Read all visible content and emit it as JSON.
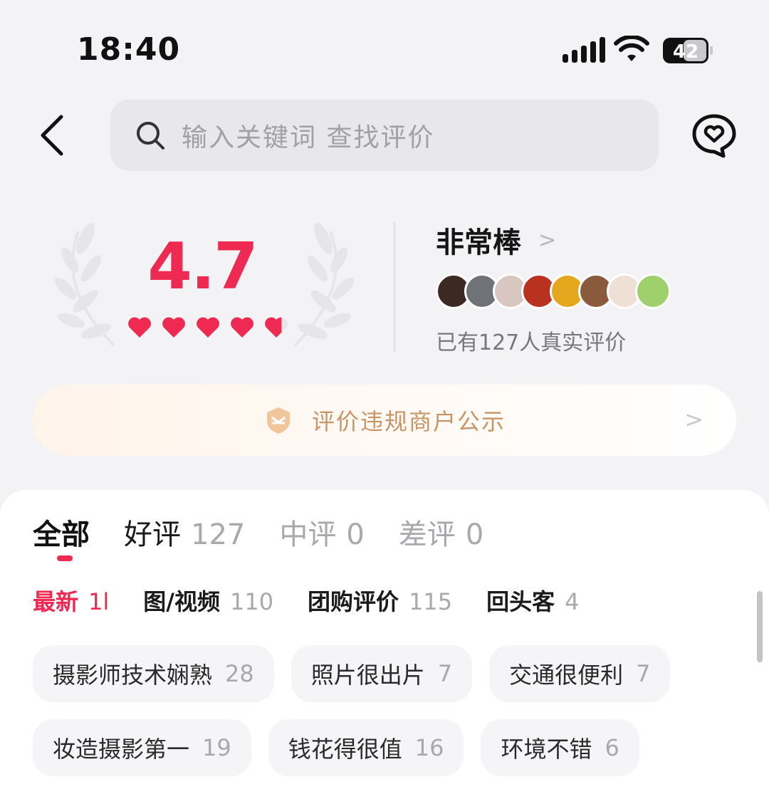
{
  "status_bar": {
    "time": "18:40",
    "battery": "42"
  },
  "search": {
    "placeholder": "输入关键词 查找评价"
  },
  "summary": {
    "score": "4.7",
    "stars_filled": 4.7,
    "rating_label": "非常棒",
    "review_count_text": "已有127人真实评价"
  },
  "avatars": [
    "#3c2a22",
    "#6f7378",
    "#d8c7c0",
    "#b8321f",
    "#e4a71e",
    "#8a5a3c",
    "#efe0d6",
    "#9fd06b"
  ],
  "notice": {
    "text": "评价违规商户公示"
  },
  "tabs": [
    {
      "label": "全部",
      "count": ""
    },
    {
      "label": "好评",
      "count": "127"
    },
    {
      "label": "中评",
      "count": "0"
    },
    {
      "label": "差评",
      "count": "0"
    }
  ],
  "filters": [
    {
      "label": "最新",
      "count": "1l"
    },
    {
      "label": "图/视频",
      "count": "110"
    },
    {
      "label": "团购评价",
      "count": "115"
    },
    {
      "label": "回头客",
      "count": "4"
    }
  ],
  "tags": [
    {
      "label": "摄影师技术娴熟",
      "count": "28"
    },
    {
      "label": "照片很出片",
      "count": "7"
    },
    {
      "label": "交通很便利",
      "count": "7"
    },
    {
      "label": "妆造摄影第一",
      "count": "19"
    },
    {
      "label": "钱花得很值",
      "count": "16"
    },
    {
      "label": "环境不错",
      "count": "6"
    }
  ],
  "colors": {
    "accent": "#ee2a53",
    "notice_text": "#c99566"
  },
  "icons": {
    "back": "chevron-left-icon",
    "search": "search-icon",
    "chat": "heart-chat-icon",
    "notice": "shield-icon",
    "rating_arrow": "chevron-right-icon"
  }
}
